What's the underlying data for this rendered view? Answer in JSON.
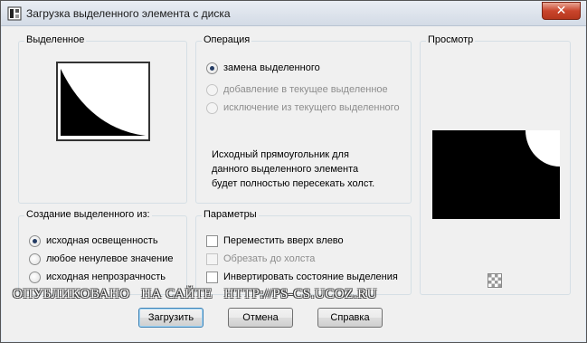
{
  "window": {
    "title": "Загрузка выделенного элемента с диска",
    "close_glyph": "✕"
  },
  "selection_group": {
    "label": "Выделенное"
  },
  "operation_group": {
    "label": "Операция",
    "options": [
      {
        "label": "замена выделенного",
        "checked": true,
        "enabled": true
      },
      {
        "label": "добавление в текущее выделенное",
        "checked": false,
        "enabled": false
      },
      {
        "label": "исключение из текущего выделенного",
        "checked": false,
        "enabled": false
      }
    ],
    "info_text": "Исходный прямоугольник для\nданного выделенного элемента\nбудет полностью пересекать холст."
  },
  "preview_group": {
    "label": "Просмотр"
  },
  "create_from_group": {
    "label": "Создание выделенного из:",
    "options": [
      {
        "label": "исходная освещенность",
        "checked": true
      },
      {
        "label": "любое ненулевое значение",
        "checked": false
      },
      {
        "label": "исходная непрозрачность",
        "checked": false
      }
    ]
  },
  "params_group": {
    "label": "Параметры",
    "options": [
      {
        "label": "Переместить вверх влево",
        "checked": false,
        "enabled": true
      },
      {
        "label": "Обрезать до холста",
        "checked": false,
        "enabled": false
      },
      {
        "label": "Инвертировать состояние выделения",
        "checked": false,
        "enabled": true
      }
    ]
  },
  "buttons": {
    "load": "Загрузить",
    "cancel": "Отмена",
    "help": "Справка"
  },
  "watermark": "ОПУБЛИКОВАНО   НА САЙТЕ   HTTP://PS-CS.UCOZ.RU",
  "icons": {
    "app": "paint-shop-icon",
    "checker": "transparency-checker-icon"
  }
}
